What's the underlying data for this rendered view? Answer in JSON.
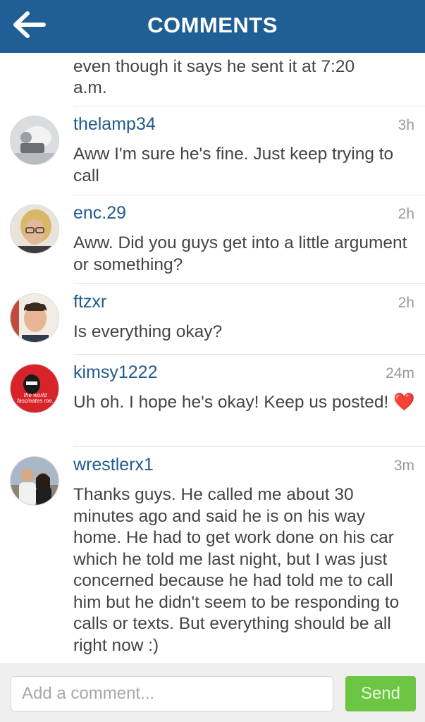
{
  "header": {
    "title": "COMMENTS",
    "back_icon": "arrow-left-icon",
    "color": "#1f5f95"
  },
  "partial_comment": {
    "line1": "even though it says he sent it at 7:20",
    "line2": "a.m."
  },
  "comments": [
    {
      "username": "thelamp34",
      "time": "3h",
      "text": "Aww I'm sure he's fine. Just keep trying to call"
    },
    {
      "username": "enc.29",
      "time": "2h",
      "text": "Aww. Did you guys get into a little argument or something?"
    },
    {
      "username": "ftzxr",
      "time": "2h",
      "text": "Is everything okay?"
    },
    {
      "username": "kimsy1222",
      "time": "24m",
      "text": "Uh oh. I hope he's okay!  Keep us posted!",
      "emoji": "❤️",
      "avatar_caption": "the world fascinates me."
    },
    {
      "username": "wrestlerx1",
      "time": "3m",
      "text": "Thanks guys. He called me about 30 minutes ago and said he is on his way home. He had to get work done on his car which he told me last night, but I was just concerned because he had told me to call him but he didn't seem to be responding to calls or texts. But everything should be all right now :)"
    }
  ],
  "composer": {
    "placeholder": "Add a comment...",
    "send_label": "Send",
    "send_color": "#6cc543"
  },
  "colors": {
    "username": "#215c8f",
    "timestamp": "#9a9a9a"
  }
}
